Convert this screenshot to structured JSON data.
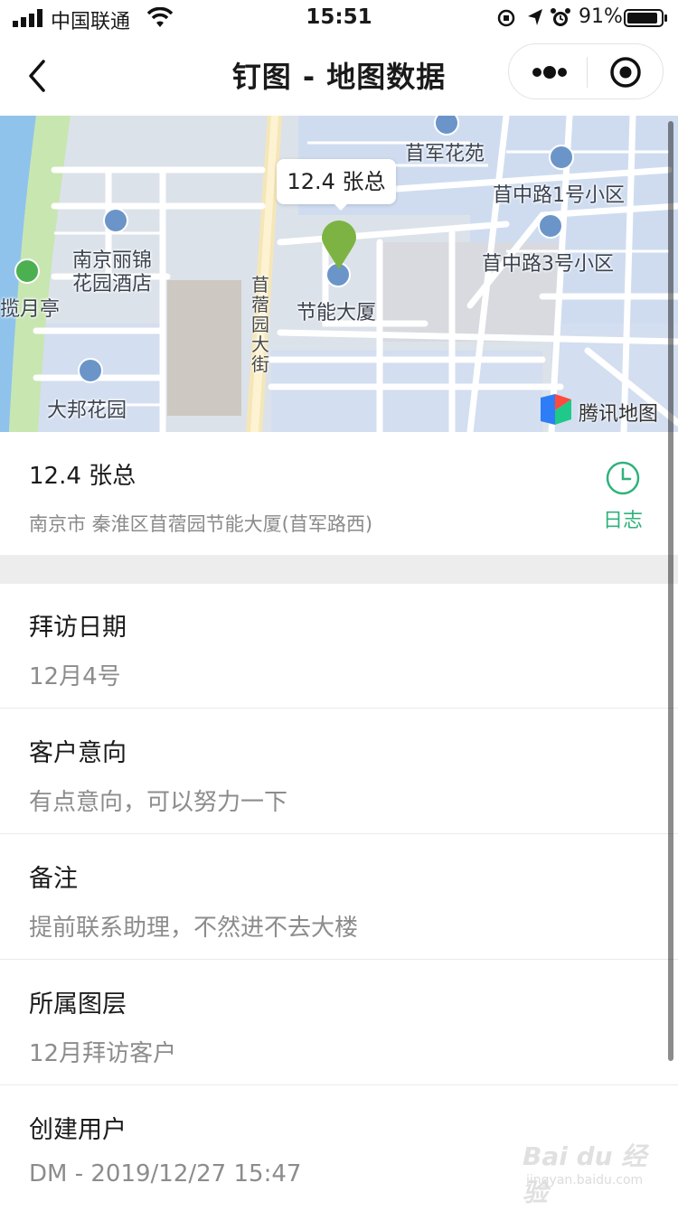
{
  "status_bar": {
    "carrier": "中国联通",
    "time": "15:51",
    "battery_percent": "91%",
    "battery_level": 0.91
  },
  "nav": {
    "title": "钉图 - 地图数据"
  },
  "map": {
    "callout": "12.4 张总",
    "provider": "腾讯地图",
    "marker_color": "#7cb342",
    "labels": {
      "guanjun_huayuan": "苜军花苑",
      "muzhonglu_1": "苜中路1号小区",
      "muzhonglu_3": "苜中路3号小区",
      "nanjing_lijin_line1": "南京丽锦",
      "nanjing_lijin_line2": "花园酒店",
      "lanyueting": "揽月亭",
      "jieneng_dasha": "节能大厦",
      "dabang_huayuan": "大邦花园",
      "road": "苜蓿园大街"
    }
  },
  "record": {
    "title": "12.4 张总",
    "address": "南京市 秦淮区苜蓿园节能大厦(苜军路西)",
    "log_label": "日志",
    "accent_color": "#2fb27c"
  },
  "fields": [
    {
      "label": "拜访日期",
      "value": "12月4号"
    },
    {
      "label": "客户意向",
      "value": "有点意向，可以努力一下"
    },
    {
      "label": "备注",
      "value": "提前联系助理，不然进不去大楼"
    },
    {
      "label": "所属图层",
      "value": "12月拜访客户"
    },
    {
      "label": "创建用户",
      "value": "DM - 2019/12/27 15:47"
    }
  ],
  "watermark": {
    "main": "Bai du 经验",
    "sub": "jingyan.baidu.com"
  }
}
